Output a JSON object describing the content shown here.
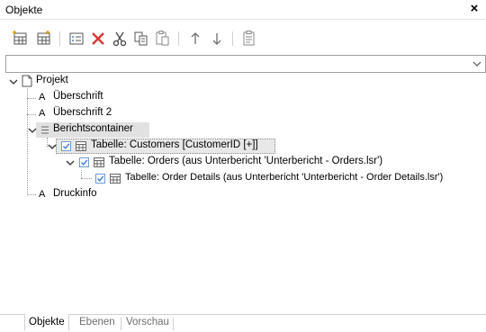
{
  "window": {
    "title": "Objekte",
    "close_glyph": "×"
  },
  "toolbar": {
    "buttons": [
      {
        "name": "new-object-icon"
      },
      {
        "name": "new-object-before-icon"
      },
      {
        "name": "properties-icon"
      },
      {
        "name": "delete-icon"
      },
      {
        "name": "cut-icon"
      },
      {
        "name": "copy-icon"
      },
      {
        "name": "paste-icon"
      },
      {
        "name": "move-up-icon"
      },
      {
        "name": "move-down-icon"
      },
      {
        "name": "clipboard-icon"
      }
    ]
  },
  "filter_combo": {
    "value": ""
  },
  "tree": {
    "nodes": [
      {
        "id": "projekt",
        "label": "Projekt",
        "icon": "page-icon",
        "expanded": true
      },
      {
        "id": "ueberschrift",
        "label": "Überschrift",
        "icon": "text-icon",
        "icon_glyph": "A"
      },
      {
        "id": "ueberschrift2",
        "label": "Überschrift 2",
        "icon": "text-icon",
        "icon_glyph": "A"
      },
      {
        "id": "berichtscontainer",
        "label": "Berichtscontainer",
        "icon": "container-icon",
        "expanded": true,
        "selected": true
      },
      {
        "id": "customers",
        "label": "Tabelle: Customers [CustomerID [+]]",
        "icon": "table-icon",
        "checked": true,
        "expanded": true,
        "focused": true
      },
      {
        "id": "orders",
        "label": "Tabelle: Orders (aus Unterbericht 'Unterbericht - Orders.lsr')",
        "icon": "table-icon",
        "checked": true,
        "expanded": true
      },
      {
        "id": "orderdetails",
        "label": "Tabelle: Order Details (aus Unterbericht 'Unterbericht - Order Details.lsr')",
        "icon": "table-icon",
        "checked": true
      },
      {
        "id": "druckinfo",
        "label": "Druckinfo",
        "icon": "text-icon",
        "icon_glyph": "A"
      }
    ]
  },
  "tabs": [
    {
      "label": "Objekte",
      "active": true
    },
    {
      "label": "Ebenen",
      "active": false
    },
    {
      "label": "Vorschau",
      "active": false
    }
  ],
  "colors": {
    "delete_red": "#d83b3b",
    "checkbox_blue": "#3c7fd6",
    "selection_gray": "#e1e1e1"
  }
}
